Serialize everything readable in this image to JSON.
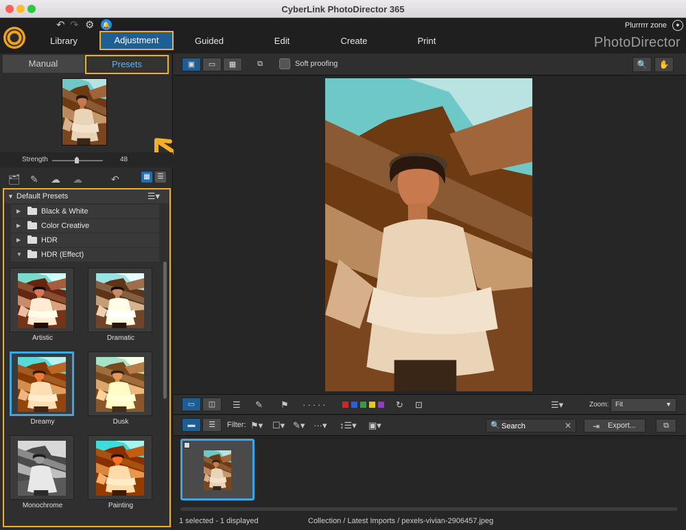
{
  "window": {
    "title": "CyberLink PhotoDirector 365",
    "traffic_colors": [
      "#fe5f57",
      "#febc2e",
      "#28c840"
    ]
  },
  "topbar": {
    "nav": [
      {
        "label": "Library"
      },
      {
        "label": "Adjustment"
      },
      {
        "label": "Guided"
      },
      {
        "label": "Edit"
      },
      {
        "label": "Create"
      },
      {
        "label": "Print"
      }
    ],
    "user": "Plurrrrr zone",
    "brand": "PhotoDirector"
  },
  "left": {
    "tabs": {
      "manual": "Manual",
      "presets": "Presets"
    },
    "strength": {
      "label": "Strength",
      "value": "48"
    },
    "default_presets": "Default Presets",
    "folders": [
      {
        "name": "Black & White"
      },
      {
        "name": "Color Creative"
      },
      {
        "name": "HDR"
      },
      {
        "name": "HDR (Effect)"
      }
    ],
    "presets": [
      {
        "name": "Artistic"
      },
      {
        "name": "Dramatic"
      },
      {
        "name": "Dreamy"
      },
      {
        "name": "Dusk"
      },
      {
        "name": "Monochrome"
      },
      {
        "name": "Painting"
      }
    ]
  },
  "toolbar": {
    "soft_proofing": "Soft proofing"
  },
  "bottom": {
    "zoom_label": "Zoom:",
    "zoom_value": "Fit",
    "filter_label": "Filter:",
    "search_placeholder": "Search",
    "export_label": "Export...",
    "color_labels": [
      "#e02020",
      "#2d5fd6",
      "#2aa33a",
      "#e8c91b",
      "#9a35d1"
    ]
  },
  "status": {
    "selection": "1 selected - 1 displayed",
    "path": "Collection / Latest Imports / pexels-vivian-2906457.jpeg"
  },
  "accent": {
    "highlight": "#f2b02a",
    "selected": "#3aa8e8"
  }
}
